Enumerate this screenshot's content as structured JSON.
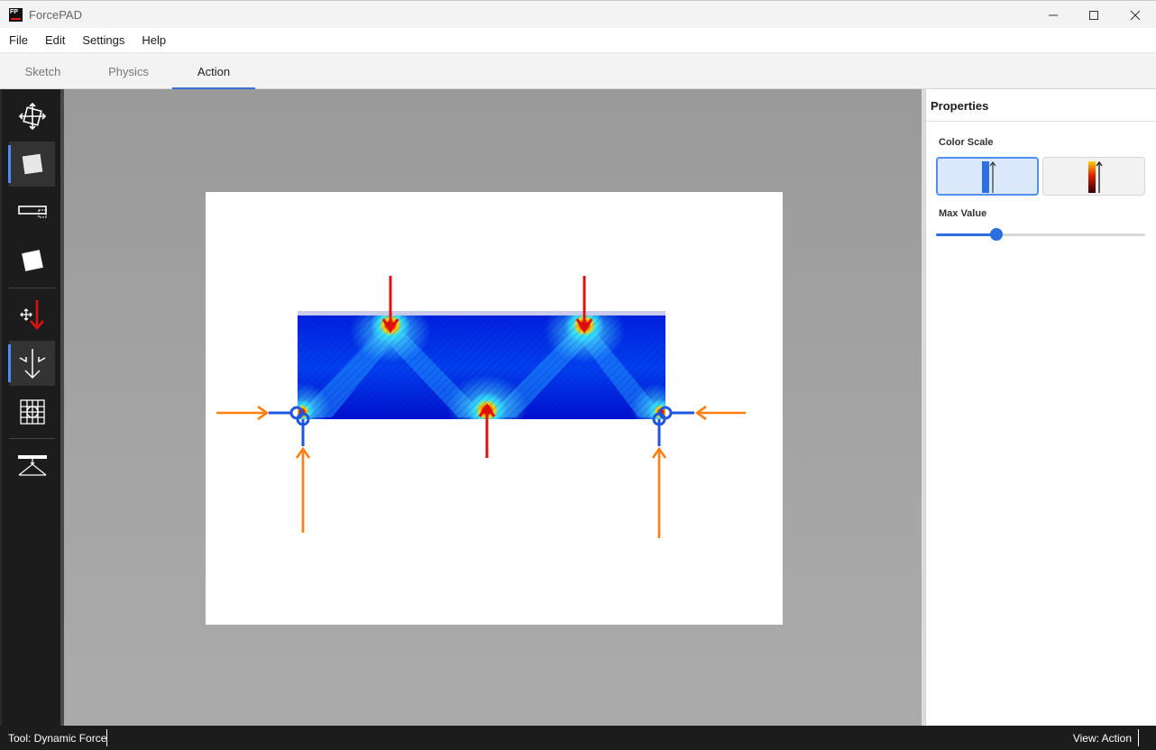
{
  "window": {
    "title": "ForcePAD",
    "icon_text": "FP"
  },
  "menu": {
    "items": [
      "File",
      "Edit",
      "Settings",
      "Help"
    ]
  },
  "tabs": [
    {
      "label": "Sketch",
      "active": false
    },
    {
      "label": "Physics",
      "active": false
    },
    {
      "label": "Action",
      "active": true
    }
  ],
  "toolbar": {
    "tools": [
      {
        "name": "move-tool",
        "icon": "move-icon",
        "selected": false
      },
      {
        "name": "material-tool",
        "icon": "material-square-icon",
        "selected": true
      },
      {
        "name": "constraint-tool",
        "icon": "constraint-bar-icon",
        "selected": false
      },
      {
        "name": "shape-tool",
        "icon": "shape-square-icon",
        "selected": false
      },
      {
        "name": "load-tool",
        "icon": "load-arrow-icon",
        "selected": false
      },
      {
        "name": "dynamic-force-tool",
        "icon": "dynamic-force-icon",
        "selected": true
      },
      {
        "name": "mesh-tool",
        "icon": "mesh-icon",
        "selected": false
      },
      {
        "name": "structure-tool",
        "icon": "structure-icon",
        "selected": false
      }
    ]
  },
  "properties": {
    "title": "Properties",
    "color_scale_label": "Color Scale",
    "color_scales": [
      {
        "name": "blue-scale",
        "selected": true
      },
      {
        "name": "heat-scale",
        "selected": false
      }
    ],
    "max_value_label": "Max Value",
    "max_value_fraction": 0.29
  },
  "colors": {
    "accent": "#3a6fd8",
    "load_arrow": "#e01010",
    "support_arrow": "#ff7f10",
    "support": "#1f55e0"
  },
  "status": {
    "tool": "Tool: Dynamic Force",
    "view": "View: Action"
  }
}
